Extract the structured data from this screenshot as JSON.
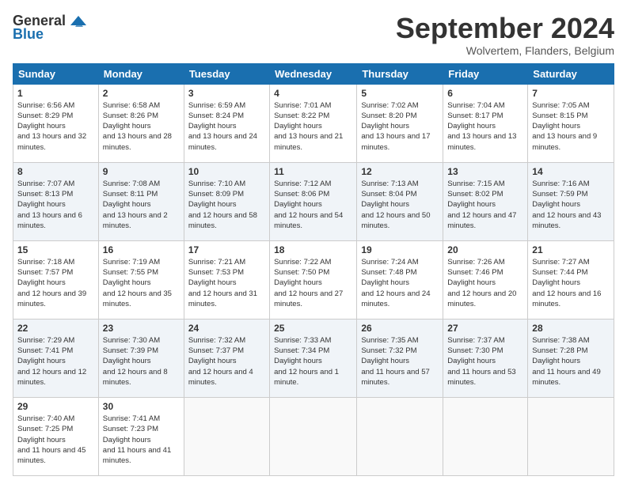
{
  "logo": {
    "line1": "General",
    "line2": "Blue"
  },
  "header": {
    "month": "September 2024",
    "location": "Wolvertem, Flanders, Belgium"
  },
  "days": [
    "Sunday",
    "Monday",
    "Tuesday",
    "Wednesday",
    "Thursday",
    "Friday",
    "Saturday"
  ],
  "weeks": [
    [
      {
        "day": "1",
        "sunrise": "6:56 AM",
        "sunset": "8:29 PM",
        "daylight": "13 hours and 32 minutes."
      },
      {
        "day": "2",
        "sunrise": "6:58 AM",
        "sunset": "8:26 PM",
        "daylight": "13 hours and 28 minutes."
      },
      {
        "day": "3",
        "sunrise": "6:59 AM",
        "sunset": "8:24 PM",
        "daylight": "13 hours and 24 minutes."
      },
      {
        "day": "4",
        "sunrise": "7:01 AM",
        "sunset": "8:22 PM",
        "daylight": "13 hours and 21 minutes."
      },
      {
        "day": "5",
        "sunrise": "7:02 AM",
        "sunset": "8:20 PM",
        "daylight": "13 hours and 17 minutes."
      },
      {
        "day": "6",
        "sunrise": "7:04 AM",
        "sunset": "8:17 PM",
        "daylight": "13 hours and 13 minutes."
      },
      {
        "day": "7",
        "sunrise": "7:05 AM",
        "sunset": "8:15 PM",
        "daylight": "13 hours and 9 minutes."
      }
    ],
    [
      {
        "day": "8",
        "sunrise": "7:07 AM",
        "sunset": "8:13 PM",
        "daylight": "13 hours and 6 minutes."
      },
      {
        "day": "9",
        "sunrise": "7:08 AM",
        "sunset": "8:11 PM",
        "daylight": "13 hours and 2 minutes."
      },
      {
        "day": "10",
        "sunrise": "7:10 AM",
        "sunset": "8:09 PM",
        "daylight": "12 hours and 58 minutes."
      },
      {
        "day": "11",
        "sunrise": "7:12 AM",
        "sunset": "8:06 PM",
        "daylight": "12 hours and 54 minutes."
      },
      {
        "day": "12",
        "sunrise": "7:13 AM",
        "sunset": "8:04 PM",
        "daylight": "12 hours and 50 minutes."
      },
      {
        "day": "13",
        "sunrise": "7:15 AM",
        "sunset": "8:02 PM",
        "daylight": "12 hours and 47 minutes."
      },
      {
        "day": "14",
        "sunrise": "7:16 AM",
        "sunset": "7:59 PM",
        "daylight": "12 hours and 43 minutes."
      }
    ],
    [
      {
        "day": "15",
        "sunrise": "7:18 AM",
        "sunset": "7:57 PM",
        "daylight": "12 hours and 39 minutes."
      },
      {
        "day": "16",
        "sunrise": "7:19 AM",
        "sunset": "7:55 PM",
        "daylight": "12 hours and 35 minutes."
      },
      {
        "day": "17",
        "sunrise": "7:21 AM",
        "sunset": "7:53 PM",
        "daylight": "12 hours and 31 minutes."
      },
      {
        "day": "18",
        "sunrise": "7:22 AM",
        "sunset": "7:50 PM",
        "daylight": "12 hours and 27 minutes."
      },
      {
        "day": "19",
        "sunrise": "7:24 AM",
        "sunset": "7:48 PM",
        "daylight": "12 hours and 24 minutes."
      },
      {
        "day": "20",
        "sunrise": "7:26 AM",
        "sunset": "7:46 PM",
        "daylight": "12 hours and 20 minutes."
      },
      {
        "day": "21",
        "sunrise": "7:27 AM",
        "sunset": "7:44 PM",
        "daylight": "12 hours and 16 minutes."
      }
    ],
    [
      {
        "day": "22",
        "sunrise": "7:29 AM",
        "sunset": "7:41 PM",
        "daylight": "12 hours and 12 minutes."
      },
      {
        "day": "23",
        "sunrise": "7:30 AM",
        "sunset": "7:39 PM",
        "daylight": "12 hours and 8 minutes."
      },
      {
        "day": "24",
        "sunrise": "7:32 AM",
        "sunset": "7:37 PM",
        "daylight": "12 hours and 4 minutes."
      },
      {
        "day": "25",
        "sunrise": "7:33 AM",
        "sunset": "7:34 PM",
        "daylight": "12 hours and 1 minute."
      },
      {
        "day": "26",
        "sunrise": "7:35 AM",
        "sunset": "7:32 PM",
        "daylight": "11 hours and 57 minutes."
      },
      {
        "day": "27",
        "sunrise": "7:37 AM",
        "sunset": "7:30 PM",
        "daylight": "11 hours and 53 minutes."
      },
      {
        "day": "28",
        "sunrise": "7:38 AM",
        "sunset": "7:28 PM",
        "daylight": "11 hours and 49 minutes."
      }
    ],
    [
      {
        "day": "29",
        "sunrise": "7:40 AM",
        "sunset": "7:25 PM",
        "daylight": "11 hours and 45 minutes."
      },
      {
        "day": "30",
        "sunrise": "7:41 AM",
        "sunset": "7:23 PM",
        "daylight": "11 hours and 41 minutes."
      },
      null,
      null,
      null,
      null,
      null
    ]
  ]
}
